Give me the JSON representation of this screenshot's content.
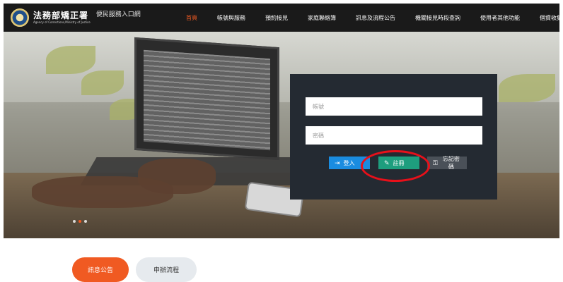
{
  "header": {
    "logo_zh": "法務部矯正署",
    "logo_en": "Agency of Corrections,Ministry of Justice",
    "portal_title": "便民服務入口網",
    "nav": [
      {
        "label": "首頁",
        "active": true
      },
      {
        "label": "帳號與服務",
        "active": false
      },
      {
        "label": "預約接見",
        "active": false
      },
      {
        "label": "家庭聯絡簿",
        "active": false
      },
      {
        "label": "訊息及流程公告",
        "active": false
      },
      {
        "label": "機關接見時段查詢",
        "active": false
      },
      {
        "label": "使用者其他功能",
        "active": false
      },
      {
        "label": "個資收集聲明",
        "active": false
      }
    ]
  },
  "login": {
    "account_placeholder": "帳號",
    "password_placeholder": "密碼",
    "login_label": "登入",
    "register_label": "註冊",
    "forgot_label": "忘記密碼"
  },
  "carousel": {
    "slides": 3,
    "active_index": 1
  },
  "tabs": [
    {
      "label": "訊息公告",
      "active": true
    },
    {
      "label": "申辦流程",
      "active": false
    }
  ],
  "colors": {
    "accent": "#f05a22",
    "login_button": "#1a8ce0",
    "register_button": "#1e9e7e",
    "highlight": "#e8101a"
  },
  "icons": {
    "login": "signin-icon",
    "register": "register-icon",
    "forgot": "key-icon"
  }
}
